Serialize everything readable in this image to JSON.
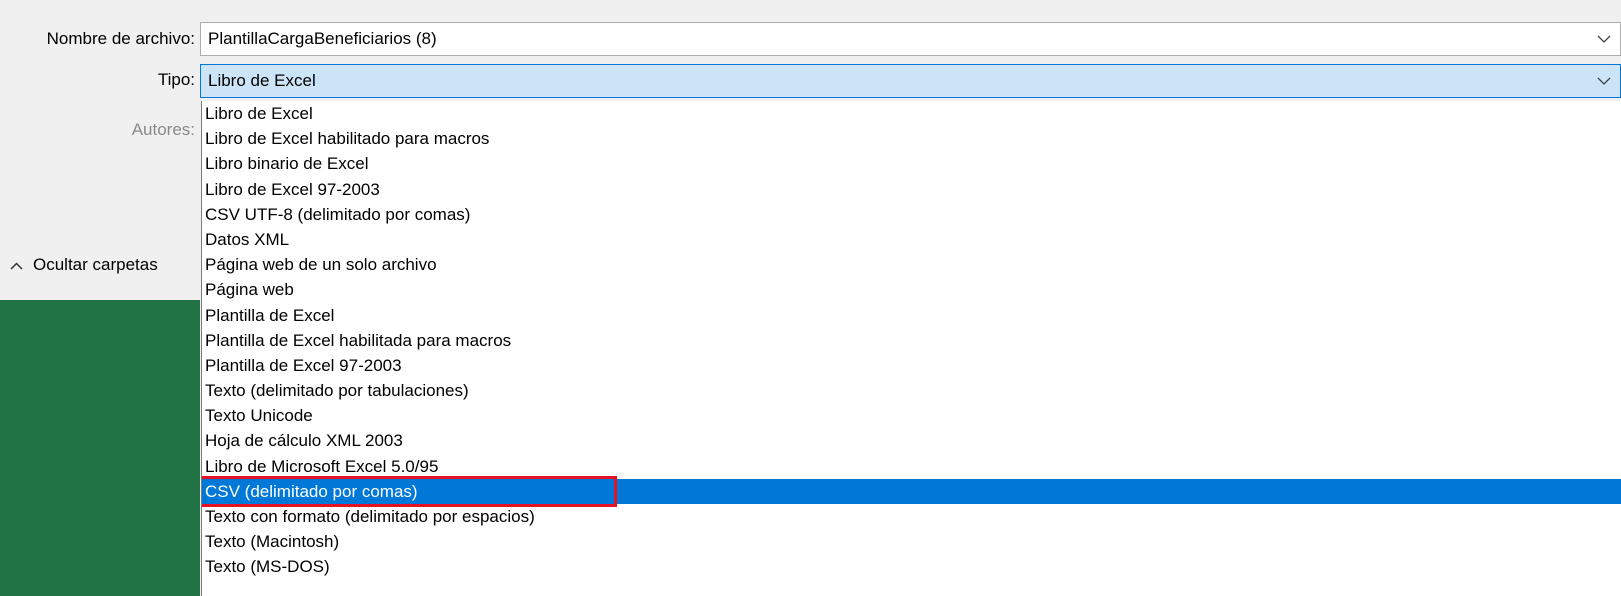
{
  "dialog": {
    "filename_label": "Nombre de archivo:",
    "filename_value": "PlantillaCargaBeneficiarios (8)",
    "type_label": "Tipo:",
    "type_value": "Libro de Excel",
    "authors_label": "Autores:",
    "hide_folders_label": "Ocultar carpetas"
  },
  "type_options": [
    "Libro de Excel",
    "Libro de Excel habilitado para macros",
    "Libro binario de Excel",
    "Libro de Excel 97-2003",
    "CSV UTF-8 (delimitado por comas)",
    "Datos XML",
    "Página web de un solo archivo",
    "Página web",
    "Plantilla de Excel",
    "Plantilla de Excel habilitada para macros",
    "Plantilla de Excel 97-2003",
    "Texto (delimitado por tabulaciones)",
    "Texto Unicode",
    "Hoja de cálculo XML 2003",
    "Libro de Microsoft Excel 5.0/95",
    "CSV (delimitado por comas)",
    "Texto con formato (delimitado por espacios)",
    "Texto (Macintosh)",
    "Texto (MS-DOS)"
  ],
  "selected_option": "CSV (delimitado por comas)",
  "colors": {
    "selection": "#0078d7",
    "highlight_box": "#e81123",
    "excel_green": "#217346",
    "active_field": "#cce4f7"
  },
  "icons": {
    "dropdown_arrow": "chevron-down-icon",
    "collapse": "chevron-up-icon"
  }
}
